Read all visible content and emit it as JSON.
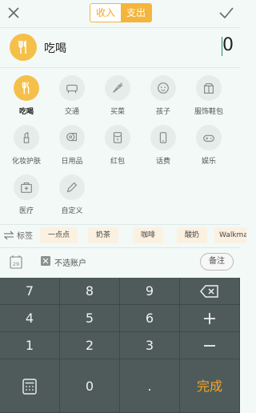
{
  "topbar": {
    "income_label": "收入",
    "expense_label": "支出"
  },
  "selected": {
    "name": "吃喝",
    "amount": "0",
    "accent": "#f5c04a"
  },
  "categories": [
    {
      "label": "吃喝"
    },
    {
      "label": "交通"
    },
    {
      "label": "买菜"
    },
    {
      "label": "孩子"
    },
    {
      "label": "服饰鞋包"
    },
    {
      "label": "化妆护肤"
    },
    {
      "label": "日用品"
    },
    {
      "label": "红包"
    },
    {
      "label": "话费"
    },
    {
      "label": "娱乐"
    },
    {
      "label": "医疗"
    },
    {
      "label": "自定义"
    }
  ],
  "tags": {
    "lead_label": "标签",
    "items": [
      "一点点",
      "奶茶",
      "咖啡",
      "酸奶",
      "Walkman"
    ]
  },
  "account": {
    "calendar_day": "29",
    "account_text": "不选账户",
    "note_label": "备注"
  },
  "keypad": {
    "keys": [
      "7",
      "8",
      "9",
      "4",
      "5",
      "6",
      "1",
      "2",
      "3",
      "0",
      "."
    ],
    "done_label": "完成"
  },
  "colors": {
    "accent": "#f5b43c",
    "keypad_bg": "#4f5b5b",
    "done": "#f5a623"
  }
}
